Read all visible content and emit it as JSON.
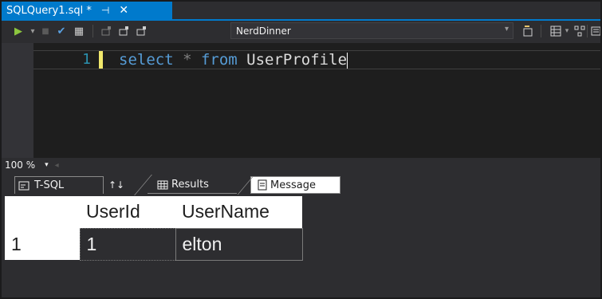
{
  "doc_tab": {
    "title": "SQLQuery1.sql *",
    "pin": "⊣",
    "close": "✕"
  },
  "toolbar": {
    "run_icon": "▶",
    "run_dd": "▾",
    "stop_icon": "■",
    "check_icon": "✔",
    "parse_icon": "▦",
    "database": "NerdDinner",
    "database_dd": "▾"
  },
  "editor": {
    "line_number": "1",
    "code_keyword1": "select",
    "code_op": " * ",
    "code_keyword2": "from",
    "code_ident": " UserProfile"
  },
  "zoom": {
    "value": "100 %",
    "dd": "▾",
    "scroll_left": "◂"
  },
  "result_tabs": {
    "tsql": "T-SQL",
    "sort": "↑↓",
    "results": "Results",
    "message": "Message"
  },
  "grid": {
    "columns": [
      "",
      "UserId",
      "UserName"
    ],
    "rows": [
      [
        "1",
        "1",
        "elton"
      ]
    ]
  }
}
